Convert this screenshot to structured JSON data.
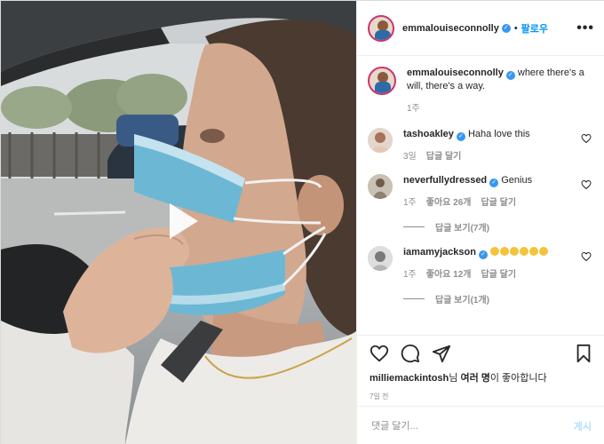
{
  "post": {
    "author": "emmalouiseconnolly",
    "follow_label": "팔로우",
    "dot": "•",
    "more": "•••",
    "caption_text": "where there's a will, there's a way.",
    "caption_time": "1주"
  },
  "comments": [
    {
      "user": "tashoakley",
      "text": "Haha love this",
      "time": "3일",
      "likes": "",
      "reply": "답글 달기"
    },
    {
      "user": "neverfullydressed",
      "text": "Genius",
      "time": "1주",
      "likes": "좋아요 26개",
      "reply": "답글 달기",
      "view_replies": "답글 보기(7개)"
    },
    {
      "user": "iamamyjackson",
      "text": "",
      "emoji_count": 6,
      "time": "1주",
      "likes": "좋아요 12개",
      "reply": "답글 달기",
      "view_replies": "답글 보기(1개)"
    }
  ],
  "likes_line": {
    "user": "milliemackintosh",
    "mid": "님 ",
    "strong": "여러 명",
    "end": "이 좋아합니다"
  },
  "posted_ago": "7일 전",
  "comment_box": {
    "placeholder": "댓글 달기...",
    "post_label": "게시"
  },
  "colors": {
    "link": "#0095f6",
    "verified": "#3897f0",
    "muted": "#8e8e8e",
    "post_disabled": "#b2dffc"
  },
  "icons": [
    "heart-icon",
    "comment-icon",
    "share-icon",
    "bookmark-icon",
    "verified-icon",
    "play-icon",
    "more-icon"
  ]
}
